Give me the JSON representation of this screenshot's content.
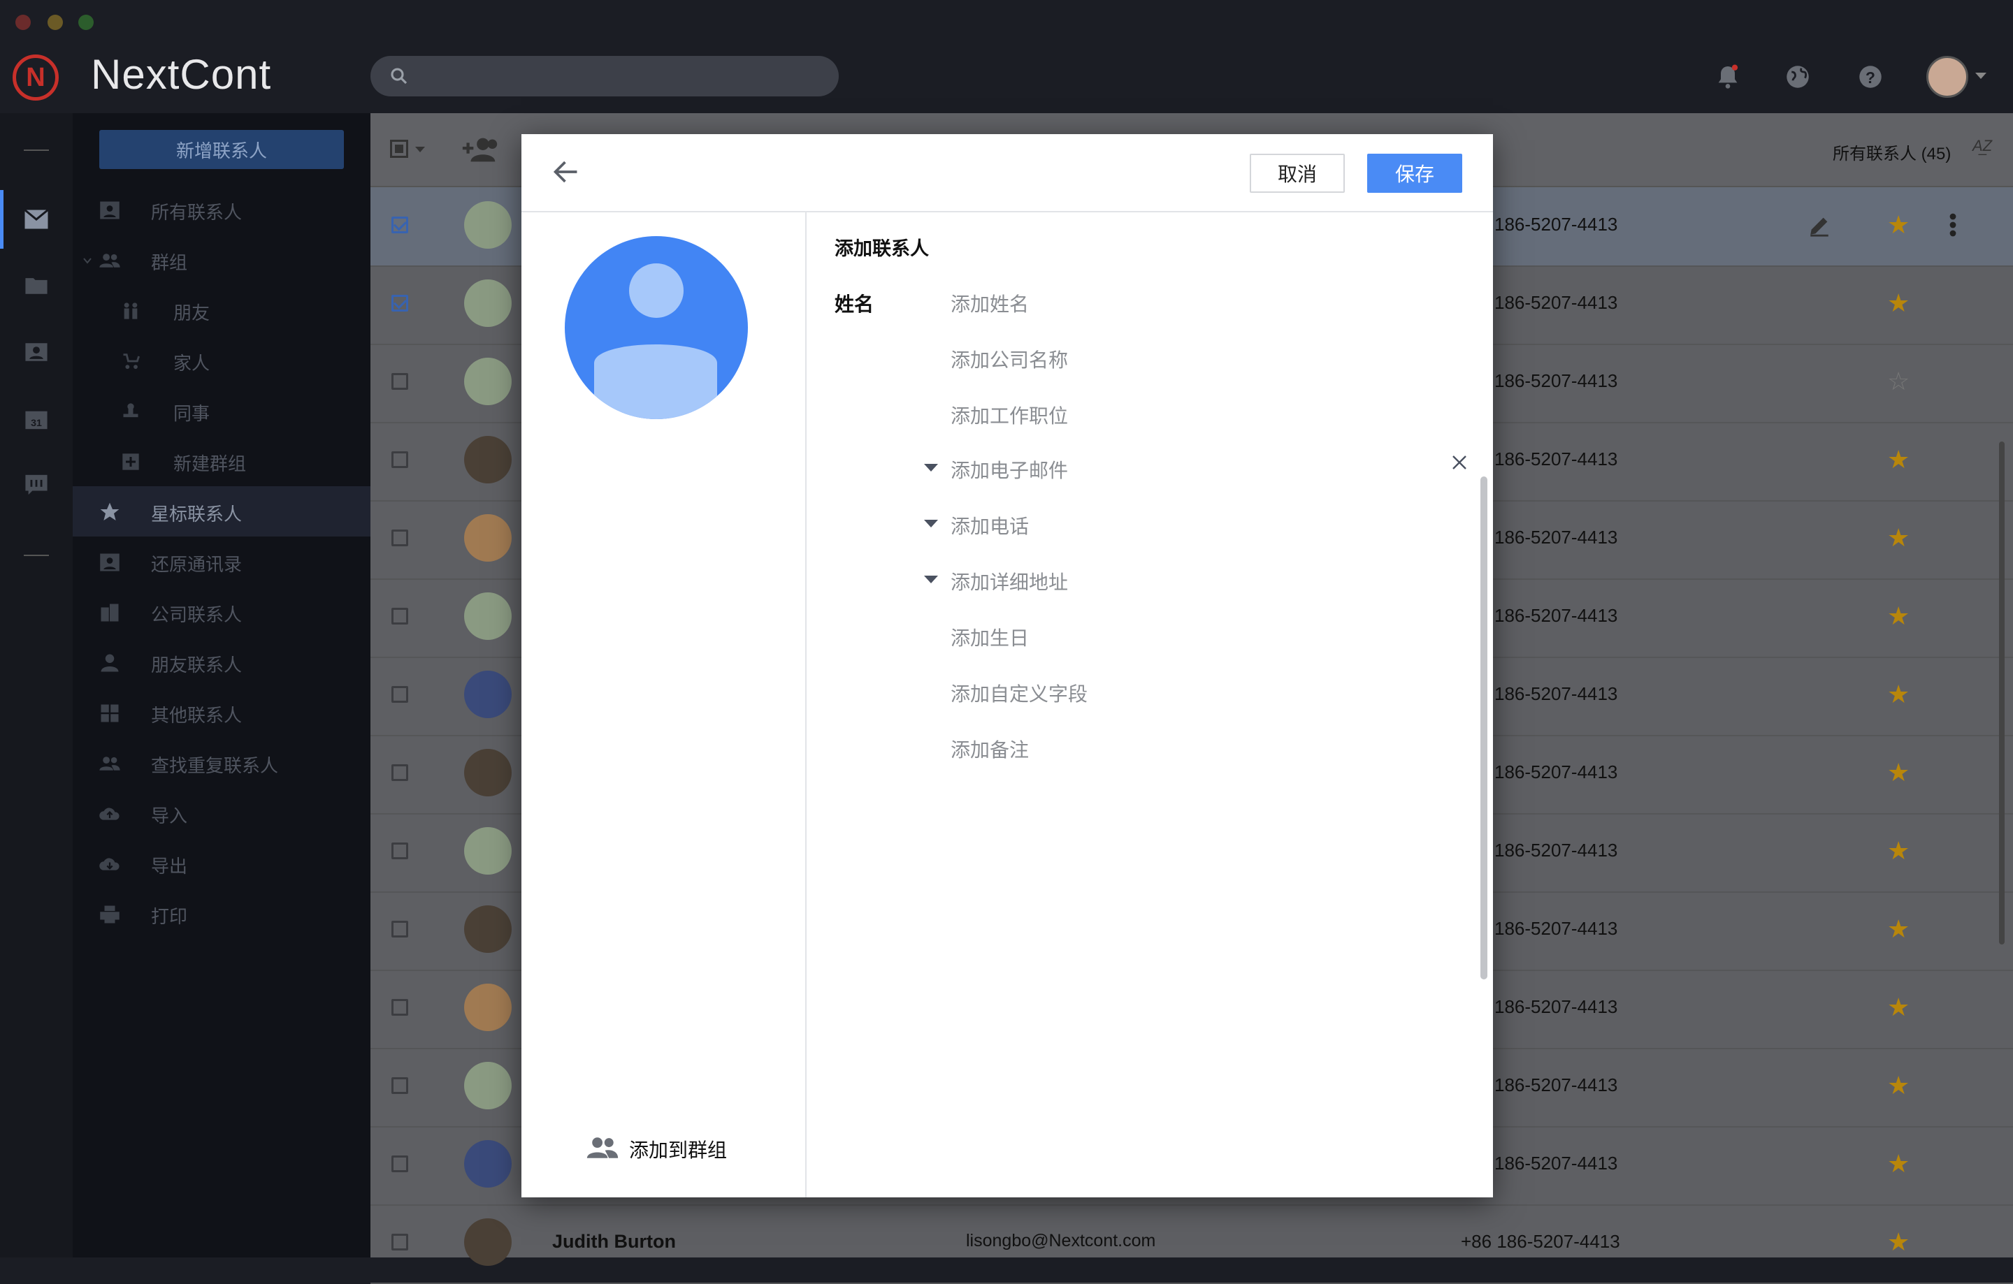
{
  "app": {
    "name": "NextCont"
  },
  "colors": {
    "accent": "#4a8bf5",
    "brand": "#c8302a",
    "star": "#f0a500"
  },
  "sidebar": {
    "new_contact_label": "新增联系人",
    "items": [
      {
        "label": "所有联系人",
        "icon": "contact-card-icon"
      },
      {
        "label": "群组",
        "icon": "group-icon"
      },
      {
        "label": "朋友",
        "icon": "friends-icon"
      },
      {
        "label": "家人",
        "icon": "stroller-icon"
      },
      {
        "label": "同事",
        "icon": "stamp-icon"
      },
      {
        "label": "新建群组",
        "icon": "plus-box-icon"
      },
      {
        "label": "星标联系人",
        "icon": "star-icon"
      },
      {
        "label": "还原通讯录",
        "icon": "restore-icon"
      },
      {
        "label": "公司联系人",
        "icon": "building-icon"
      },
      {
        "label": "朋友联系人",
        "icon": "person-icon"
      },
      {
        "label": "其他联系人",
        "icon": "grid-icon"
      },
      {
        "label": "查找重复联系人",
        "icon": "people-icon"
      },
      {
        "label": "导入",
        "icon": "cloud-upload-icon"
      },
      {
        "label": "导出",
        "icon": "cloud-download-icon"
      },
      {
        "label": "打印",
        "icon": "printer-icon"
      }
    ]
  },
  "toolbar": {
    "filter_label": "所有联系人 (45)"
  },
  "list": {
    "rows": [
      {
        "phone": "186-5207-4413",
        "checked": true,
        "starred": true
      },
      {
        "phone": "186-5207-4413",
        "checked": true,
        "starred": true
      },
      {
        "phone": "186-5207-4413",
        "checked": false,
        "starred": false
      },
      {
        "phone": "186-5207-4413",
        "checked": false,
        "starred": true
      },
      {
        "phone": "186-5207-4413",
        "checked": false,
        "starred": true
      },
      {
        "phone": "186-5207-4413",
        "checked": false,
        "starred": true
      },
      {
        "phone": "186-5207-4413",
        "checked": false,
        "starred": true
      },
      {
        "phone": "186-5207-4413",
        "checked": false,
        "starred": true
      },
      {
        "phone": "186-5207-4413",
        "checked": false,
        "starred": true
      },
      {
        "phone": "186-5207-4413",
        "checked": false,
        "starred": true
      },
      {
        "phone": "186-5207-4413",
        "checked": false,
        "starred": true
      },
      {
        "phone": "186-5207-4413",
        "checked": false,
        "starred": true
      },
      {
        "phone": "186-5207-4413",
        "checked": false,
        "starred": true
      }
    ],
    "last_row": {
      "name": "Judith Burton",
      "email": "lisongbo@Nextcont.com",
      "phone": "+86 186-5207-4413"
    }
  },
  "dialog": {
    "cancel_label": "取消",
    "save_label": "保存",
    "section_title": "添加联系人",
    "name_label": "姓名",
    "fields": {
      "name": "添加姓名",
      "company": "添加公司名称",
      "job": "添加工作职位",
      "email": "添加电子邮件",
      "phone": "添加电话",
      "address": "添加详细地址",
      "birthday": "添加生日",
      "custom": "添加自定义字段",
      "note": "添加备注"
    },
    "add_to_group_label": "添加到群组"
  }
}
